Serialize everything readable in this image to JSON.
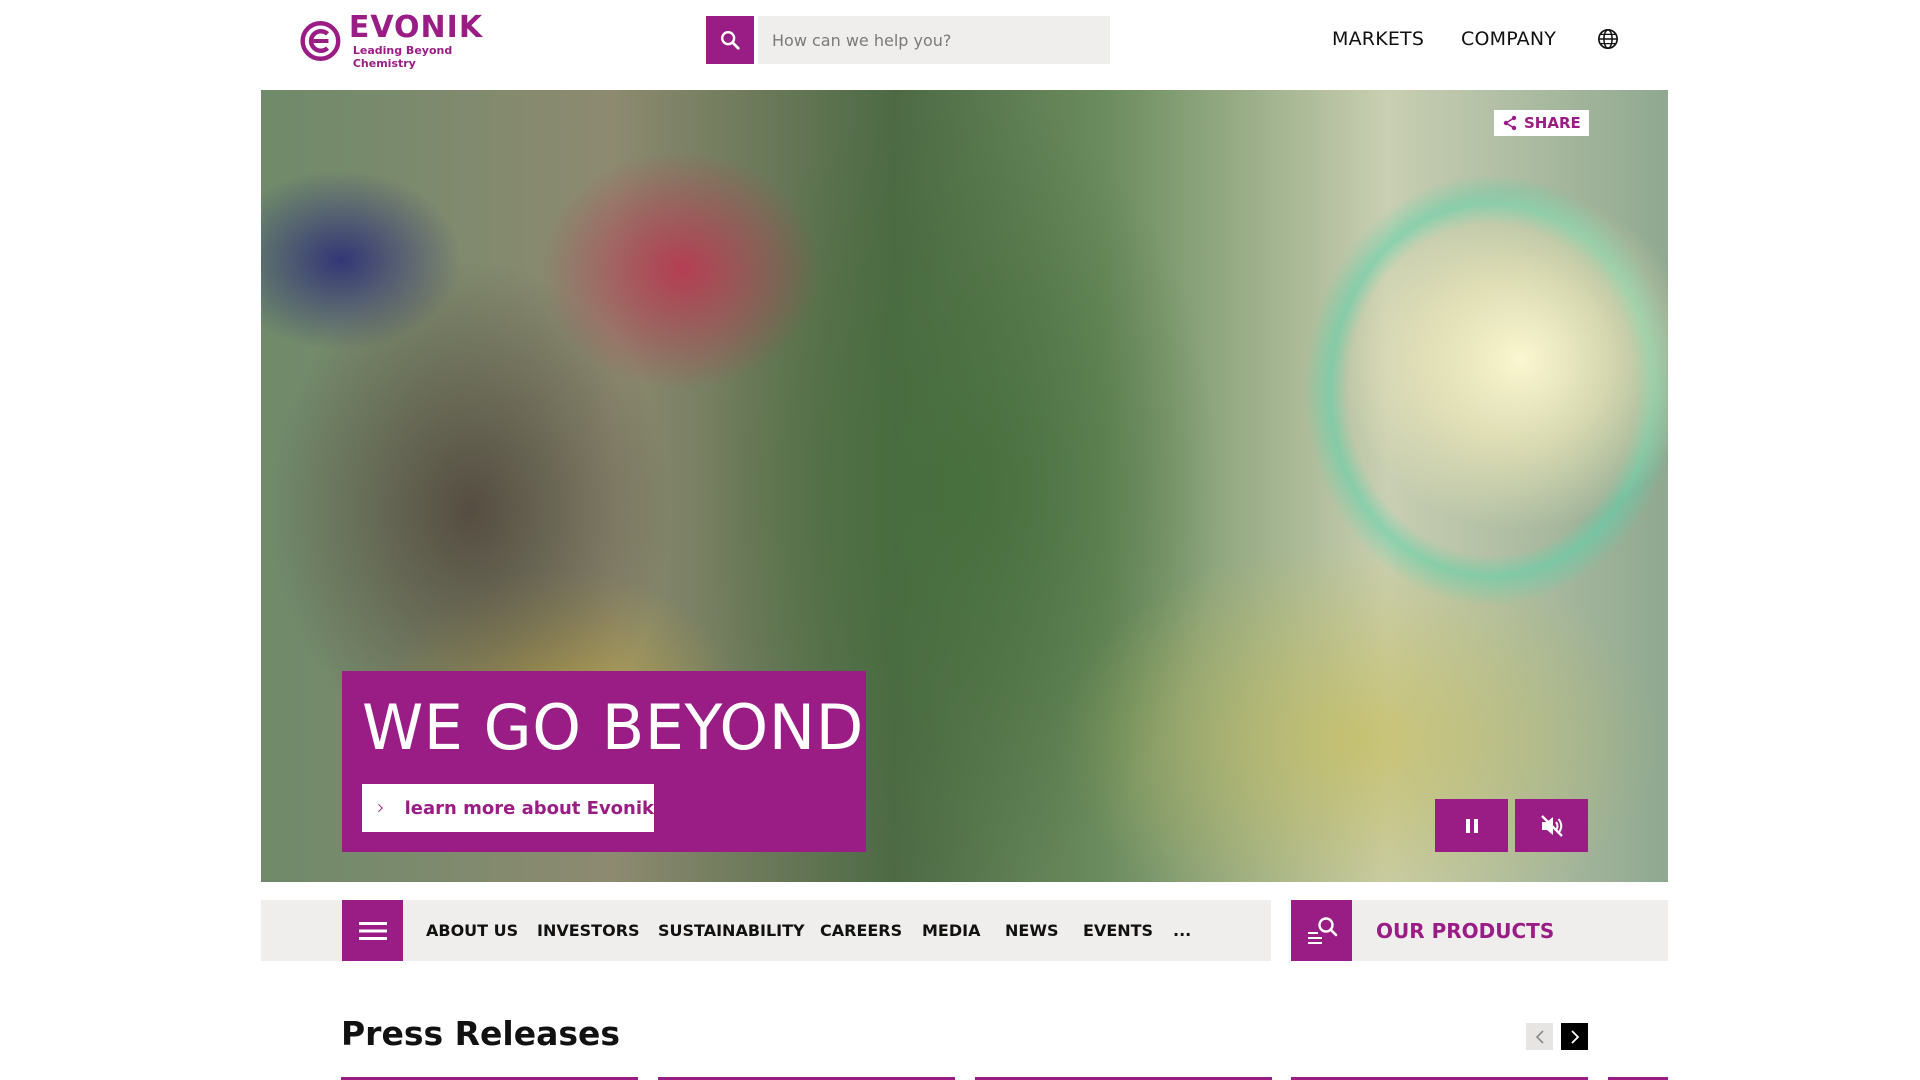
{
  "brand": {
    "name": "EVONIK",
    "tagline": "Leading Beyond Chemistry",
    "primary_color": "#991d85"
  },
  "header": {
    "search": {
      "placeholder": "How can we help you?",
      "icon": "search-icon"
    },
    "nav": [
      {
        "label": "MARKETS"
      },
      {
        "label": "COMPANY"
      }
    ],
    "language_icon": "globe-icon"
  },
  "hero": {
    "share_label": "SHARE",
    "headline": "WE GO BEYOND",
    "cta_label": "learn more about Evonik",
    "controls": {
      "pause_icon": "pause-icon",
      "mute_icon": "mute-icon"
    }
  },
  "main_nav": {
    "menu_icon": "hamburger-icon",
    "items": [
      {
        "label": "ABOUT US"
      },
      {
        "label": "INVESTORS"
      },
      {
        "label": "SUSTAINABILITY"
      },
      {
        "label": "CAREERS"
      },
      {
        "label": "MEDIA"
      },
      {
        "label": "NEWS"
      },
      {
        "label": "EVENTS"
      },
      {
        "label": "..."
      }
    ],
    "products_label": "OUR PRODUCTS"
  },
  "press": {
    "title": "Press Releases"
  }
}
